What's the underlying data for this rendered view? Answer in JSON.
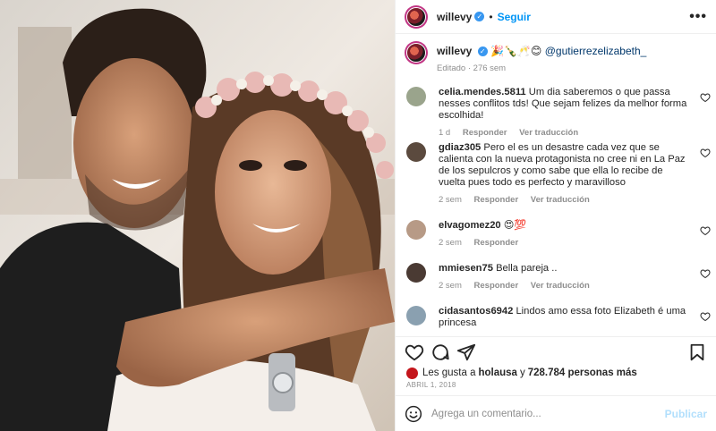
{
  "post": {
    "username": "willevy",
    "follow_label": "Seguir",
    "more_label": "•••",
    "caption_emojis": "🎉🍾🥂😊",
    "caption_mention": "@gutierrezelizabeth_",
    "caption_meta": "Editado · 276 sem",
    "date": "ABRIL 1, 2018"
  },
  "comments": [
    {
      "user": "celia.mendes.5811",
      "text": "Um dia saberemos o que passa nesses conflitos tds! Que sejam felizes da melhor forma escolhida!",
      "time": "1 d",
      "reply_label": "Responder",
      "translate_label": "Ver traducción",
      "avatar_color": "#9aa48c"
    },
    {
      "user": "gdiaz305",
      "text": "Pero el es un desastre cada vez que se calienta con la nueva protagonista no cree ni en La Paz de los sepulcros y como sabe que ella lo recibe de vuelta pues todo es perfecto y maravilloso",
      "time": "2 sem",
      "reply_label": "Responder",
      "translate_label": "Ver traducción",
      "avatar_color": "#5b4a3e"
    },
    {
      "user": "elvagomez20",
      "text": "😍💯",
      "time": "2 sem",
      "reply_label": "Responder",
      "translate_label": "",
      "avatar_color": "#b79a86"
    },
    {
      "user": "mmiesen75",
      "text": "Bella pareja ..",
      "time": "2 sem",
      "reply_label": "Responder",
      "translate_label": "Ver traducción",
      "avatar_color": "#4a3a33"
    },
    {
      "user": "cidasantos6942",
      "text": "Lindos amo essa foto Elizabeth é uma princesa",
      "time": "",
      "reply_label": "",
      "translate_label": "",
      "avatar_color": "#8aa0b0"
    }
  ],
  "likes": {
    "prefix": "Les gusta a",
    "user": "holausa",
    "joiner": "y",
    "count": "728.784 personas más"
  },
  "composer": {
    "placeholder": "Agrega un comentario...",
    "publish_label": "Publicar"
  },
  "icons": [
    "heart-icon",
    "comment-icon",
    "share-icon",
    "bookmark-icon",
    "emoji-icon",
    "verified-icon",
    "more-icon"
  ],
  "colors": {
    "accent": "#0095f6",
    "publish_disabled": "#b2dffc",
    "meta": "#8e8e8e"
  }
}
